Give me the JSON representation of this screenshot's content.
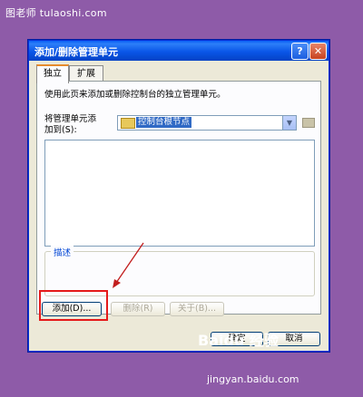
{
  "watermark_top": "图老师 tulaoshi.com",
  "dialog": {
    "title": "添加/删除管理单元",
    "help_button": "?",
    "close_button": "✕",
    "tabs": [
      "独立",
      "扩展"
    ],
    "description": "使用此页来添加或删除控制台的独立管理单元。",
    "add_to_label": "将管理单元添加到(S):",
    "add_to_value": "控制台根节点",
    "dropdown_arrow": "▼",
    "description_group_label": "描述",
    "buttons": {
      "add": "添加(D)...",
      "delete": "删除(R)",
      "about": "关于(B)...",
      "ok": "确定",
      "cancel": "取消"
    }
  },
  "watermark_baidu": "Baidu 经验",
  "watermark_bottom": "jingyan.baidu.com"
}
